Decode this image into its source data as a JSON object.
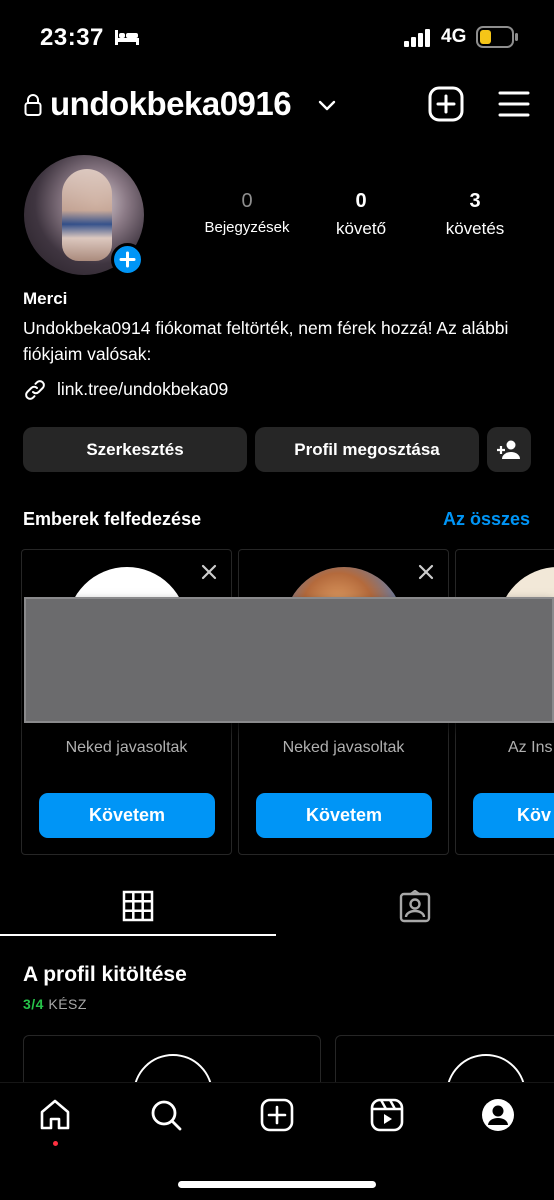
{
  "status_bar": {
    "time": "23:37",
    "network": "4G",
    "battery_color": "#f5c518"
  },
  "header": {
    "username": "undokbeka0916"
  },
  "profile": {
    "posts_count": "0",
    "posts_label": "Bejegyzések",
    "followers_count": "0",
    "followers_label": "követő",
    "following_count": "3",
    "following_label": "követés",
    "name": "Merci",
    "bio": "Undokbeka0914 fiókomat feltörték, nem férek hozzá! Az alábbi fiókjaim valósak:",
    "link": "link.tree/undokbeka09"
  },
  "actions": {
    "edit_label": "Szerkesztés",
    "share_label": "Profil megosztása"
  },
  "discover": {
    "title": "Emberek felfedezése",
    "see_all": "Az összes",
    "cards": [
      {
        "subtitle": "Neked javasoltak",
        "follow_label": "Követem"
      },
      {
        "subtitle": "Neked javasoltak",
        "follow_label": "Követem"
      },
      {
        "subtitle": "Az Ins… ajánl…",
        "follow_label": "Köv"
      }
    ]
  },
  "complete_profile": {
    "title": "A profil kitöltése",
    "progress_done": "3/4",
    "progress_label": "KÉSZ"
  },
  "colors": {
    "accent": "#0095f6",
    "progress_green": "#27c34a",
    "notification_dot": "#ff3040"
  },
  "icons": [
    "bed-icon",
    "signal-icon",
    "battery-icon",
    "lock-icon",
    "chevron-down-icon",
    "add-post-icon",
    "menu-icon",
    "plus-icon",
    "link-icon",
    "add-person-icon",
    "close-icon",
    "grid-icon",
    "tagged-icon",
    "home-icon",
    "search-icon",
    "new-post-icon",
    "reels-icon",
    "profile-icon"
  ]
}
